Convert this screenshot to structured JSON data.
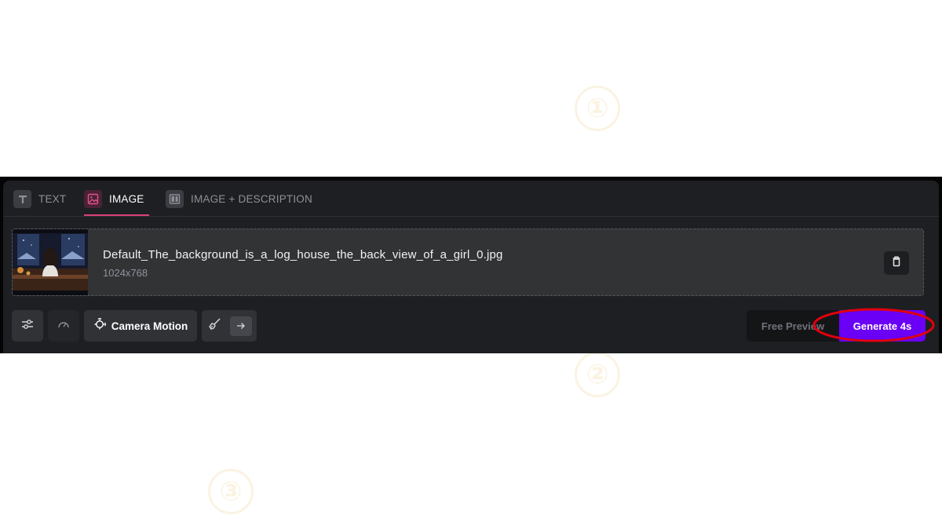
{
  "markers": [
    "①",
    "②",
    "③"
  ],
  "tabs": {
    "text": {
      "label": "TEXT",
      "icon": "text-T-icon"
    },
    "image": {
      "label": "IMAGE",
      "icon": "image-icon",
      "active": true
    },
    "image_desc": {
      "label": "IMAGE + DESCRIPTION",
      "icon": "split-layout-icon"
    }
  },
  "file": {
    "name": "Default_The_background_is_a_log_house_the_back_view_of_a_girl_0.jpg",
    "dimensions": "1024x768"
  },
  "toolbar": {
    "camera_motion_label": "Camera Motion",
    "free_preview_label": "Free Preview",
    "generate_label": "Generate 4s"
  },
  "colors": {
    "panel": "#1e1f22",
    "accent_pink": "#d9407a",
    "generate_purple": "#6a00f5",
    "highlight_red": "#e0000e"
  }
}
